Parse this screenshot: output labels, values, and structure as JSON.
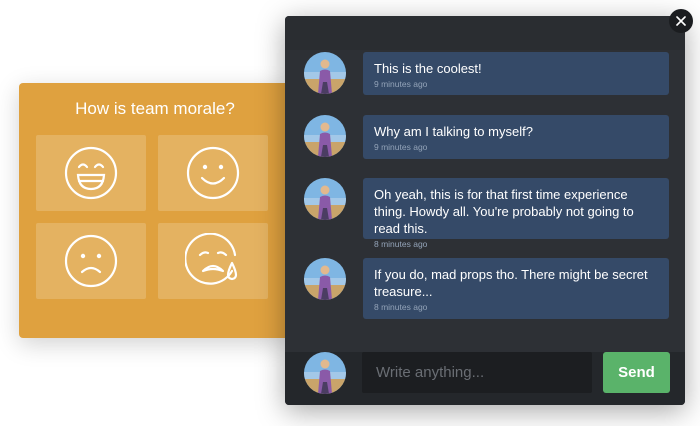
{
  "poll": {
    "title": "How is team morale?",
    "options": [
      {
        "icon": "grinning-face-icon"
      },
      {
        "icon": "smiling-face-icon"
      },
      {
        "icon": "frowning-face-icon"
      },
      {
        "icon": "crying-face-icon"
      }
    ],
    "background_color": "#dfa13f"
  },
  "chat": {
    "messages": [
      {
        "text": "This is the coolest!",
        "time": "9 minutes ago"
      },
      {
        "text": "Why am I talking to myself?",
        "time": "9 minutes ago"
      },
      {
        "text": "Oh yeah, this is for that first time experience thing. Howdy all. You're probably not going to read this.",
        "time": "8 minutes ago"
      },
      {
        "text": "If you do, mad props tho. There might be secret treasure...",
        "time": "8 minutes ago"
      }
    ],
    "input_placeholder": "Write anything...",
    "send_label": "Send",
    "bubble_color": "#354a68",
    "send_color": "#5ab36a"
  },
  "icons": {
    "close": "close-icon",
    "avatar": "user-avatar-icon"
  }
}
